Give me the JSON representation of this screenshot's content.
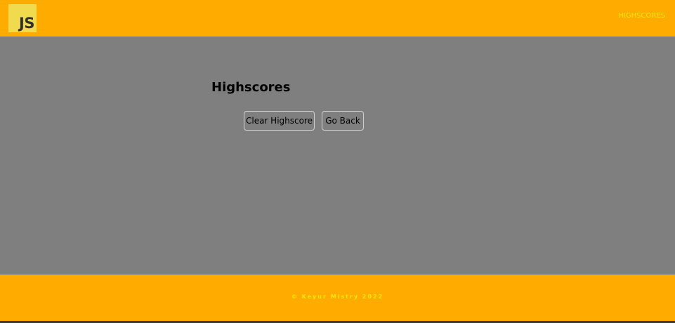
{
  "header": {
    "logo_text": "JS",
    "nav_link": "HIGHSCORES"
  },
  "main": {
    "title": "Highscores",
    "clear_button": "Clear Highscore",
    "back_button": "Go Back"
  },
  "footer": {
    "copyright": "© Keyur Mistry 2022"
  },
  "colors": {
    "header_bg": "#ffab00",
    "main_bg": "#7f7f7f",
    "link": "#f5e600",
    "logo_bg": "#f0db4f"
  }
}
